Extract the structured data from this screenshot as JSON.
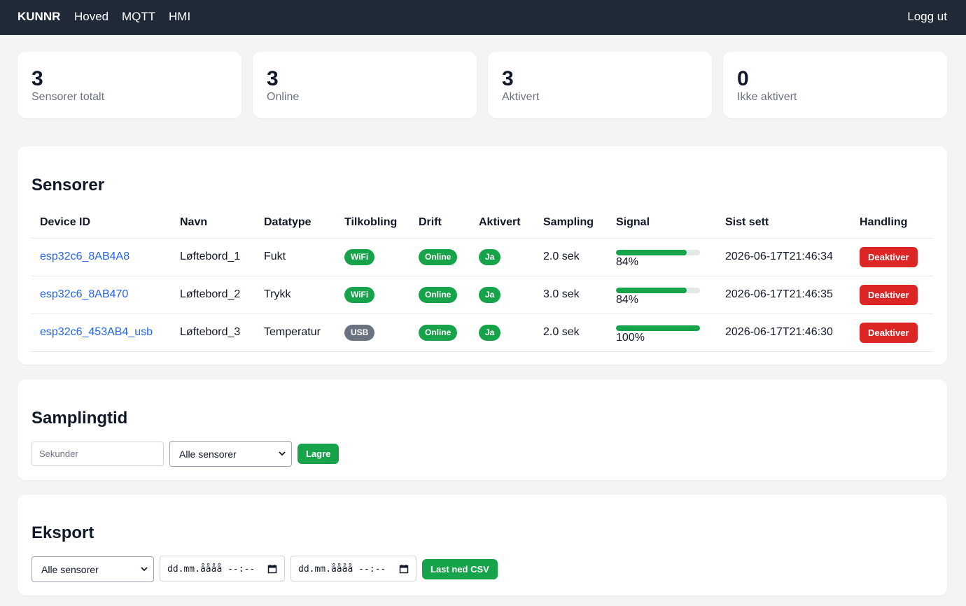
{
  "nav": {
    "brand": "KUNNR",
    "links": [
      "Hoved",
      "MQTT",
      "HMI"
    ],
    "logout": "Logg ut"
  },
  "stats": [
    {
      "value": "3",
      "label": "Sensorer totalt"
    },
    {
      "value": "3",
      "label": "Online"
    },
    {
      "value": "3",
      "label": "Aktivert"
    },
    {
      "value": "0",
      "label": "Ikke aktivert"
    }
  ],
  "sensors": {
    "title": "Sensorer",
    "columns": [
      "Device ID",
      "Navn",
      "Datatype",
      "Tilkobling",
      "Drift",
      "Aktivert",
      "Sampling",
      "Signal",
      "Sist sett",
      "Handling"
    ],
    "rows": [
      {
        "device_id": "esp32c6_8AB4A8",
        "name": "Løftebord_1",
        "datatype": "Fukt",
        "connection": "WiFi",
        "status": "Online",
        "enabled": "Ja",
        "sampling": "2.0 sek",
        "signal": 84,
        "signal_label": "84%",
        "last_seen": "2026-06-17T21:46:34",
        "action": "Deaktiver"
      },
      {
        "device_id": "esp32c6_8AB470",
        "name": "Løftebord_2",
        "datatype": "Trykk",
        "connection": "WiFi",
        "status": "Online",
        "enabled": "Ja",
        "sampling": "3.0 sek",
        "signal": 84,
        "signal_label": "84%",
        "last_seen": "2026-06-17T21:46:35",
        "action": "Deaktiver"
      },
      {
        "device_id": "esp32c6_453AB4_usb",
        "name": "Løftebord_3",
        "datatype": "Temperatur",
        "connection": "USB",
        "status": "Online",
        "enabled": "Ja",
        "sampling": "2.0 sek",
        "signal": 100,
        "signal_label": "100%",
        "last_seen": "2026-06-17T21:46:30",
        "action": "Deaktiver"
      }
    ]
  },
  "sampling": {
    "title": "Samplingtid",
    "seconds_placeholder": "Sekunder",
    "seconds_value": "",
    "sensor_select": "Alle sensorer",
    "save_label": "Lagre"
  },
  "export": {
    "title": "Eksport",
    "sensor_select": "Alle sensorer",
    "from_date": "dd.mm.åååå --:--",
    "to_date": "dd.mm.åååå --:--",
    "download_label": "Last ned CSV"
  },
  "colors": {
    "navbar": "#1f2937",
    "accent_green": "#16a34a",
    "danger_red": "#dc2626",
    "link_blue": "#2563eb",
    "badge_gray": "#6b7280"
  },
  "icons": [
    "chevron-down-icon",
    "calendar-icon"
  ]
}
